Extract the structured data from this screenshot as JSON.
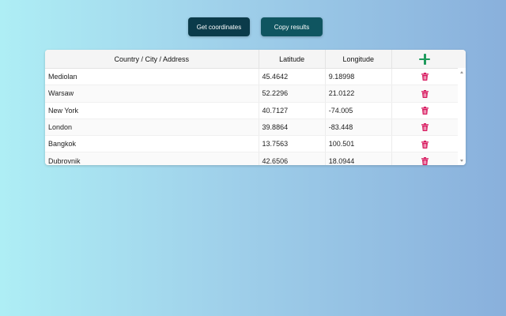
{
  "toolbar": {
    "get_coordinates_label": "Get coordinates",
    "copy_results_label": "Copy results"
  },
  "table": {
    "headers": {
      "location": "Country / City / Address",
      "latitude": "Latitude",
      "longitude": "Longitude",
      "add_icon": "plus-icon"
    },
    "rows": [
      {
        "location": "Mediolan",
        "latitude": "45.4642",
        "longitude": "9.18998"
      },
      {
        "location": "Warsaw",
        "latitude": "52.2296",
        "longitude": "21.0122"
      },
      {
        "location": "New York",
        "latitude": "40.7127",
        "longitude": "-74.005"
      },
      {
        "location": "London",
        "latitude": "39.8864",
        "longitude": "-83.448"
      },
      {
        "location": "Bangkok",
        "latitude": "13.7563",
        "longitude": "100.501"
      },
      {
        "location": "Dubrovnik",
        "latitude": "42.6506",
        "longitude": "18.0944"
      }
    ],
    "row_action_icon": "trash-icon"
  },
  "colors": {
    "button_primary": "#0b3b4a",
    "button_secondary": "#0f5560",
    "add_icon": "#1e9a5c",
    "delete_icon": "#d81b60"
  }
}
